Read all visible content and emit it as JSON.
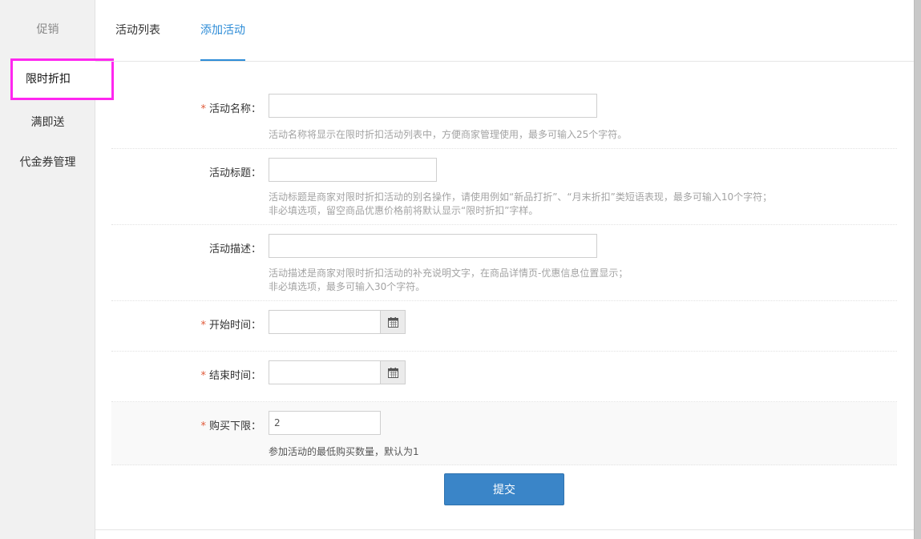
{
  "sidebar": {
    "title": "促销",
    "items": [
      {
        "label": "限时折扣",
        "active": true
      },
      {
        "label": "满即送"
      },
      {
        "label": "代金券管理"
      }
    ]
  },
  "tabs": [
    {
      "label": "活动列表"
    },
    {
      "label": "添加活动",
      "active": true
    }
  ],
  "form": {
    "name": {
      "label": "活动名称：",
      "required": true,
      "value": "",
      "hint": "活动名称将显示在限时折扣活动列表中，方便商家管理使用，最多可输入25个字符。"
    },
    "title": {
      "label": "活动标题：",
      "value": "",
      "hint_line1": "活动标题是商家对限时折扣活动的别名操作，请使用例如“新品打折”、“月末折扣”类短语表现，最多可输入10个字符；",
      "hint_line2": "非必填选项，留空商品优惠价格前将默认显示“限时折扣”字样。"
    },
    "description": {
      "label": "活动描述：",
      "value": "",
      "hint_line1": "活动描述是商家对限时折扣活动的补充说明文字，在商品详情页-优惠信息位置显示；",
      "hint_line2": "非必填选项，最多可输入30个字符。"
    },
    "start_time": {
      "label": "开始时间：",
      "required": true,
      "value": ""
    },
    "end_time": {
      "label": "结束时间：",
      "required": true,
      "value": ""
    },
    "min_purchase": {
      "label": "购买下限：",
      "required": true,
      "value": "2",
      "hint": "参加活动的最低购买数量，默认为1"
    },
    "required_mark": "*"
  },
  "submit_label": "提交",
  "icons": {
    "calendar": "calendar-icon"
  },
  "colors": {
    "accent": "#2d8cd7",
    "button": "#3a85c8",
    "highlight": "#ff27f0",
    "required": "#e05a3a"
  }
}
